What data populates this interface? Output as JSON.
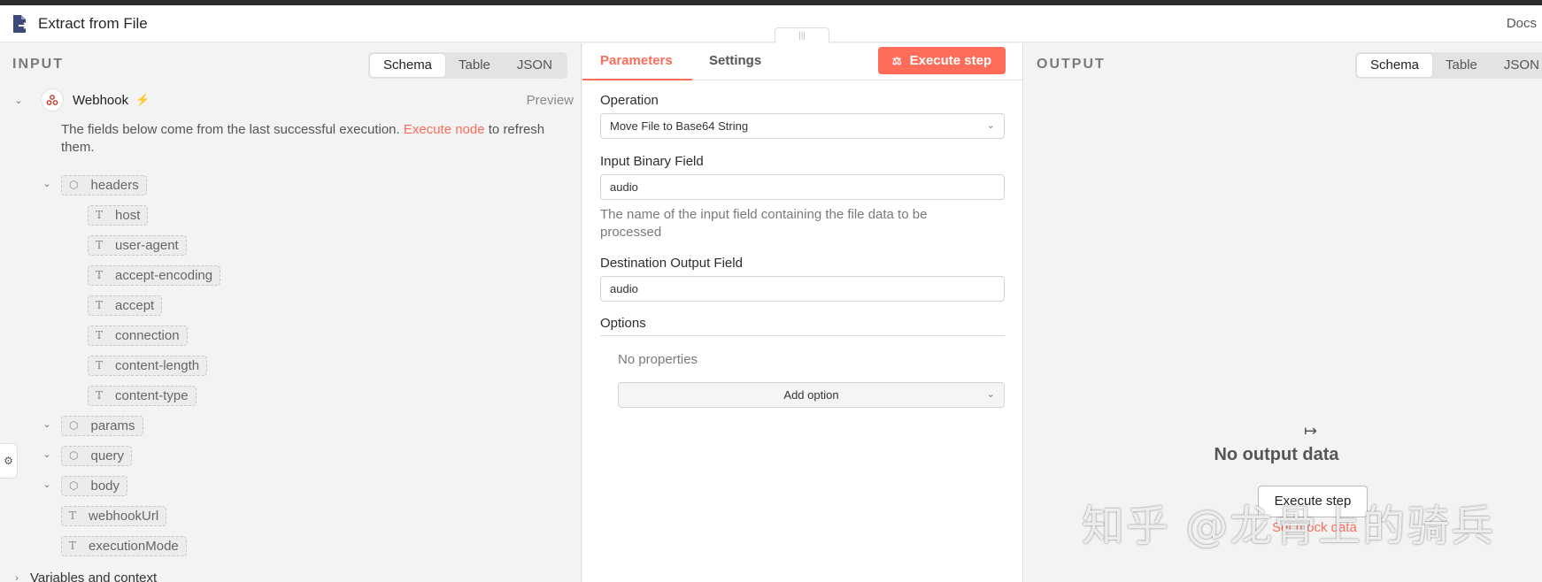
{
  "header": {
    "title": "Extract from File",
    "docs_label": "Docs"
  },
  "input_panel": {
    "label": "INPUT",
    "view_tabs": [
      "Schema",
      "Table",
      "JSON"
    ],
    "node": {
      "name": "Webhook",
      "preview_label": "Preview"
    },
    "info": {
      "text_before": "The fields below come from the last successful execution. ",
      "link": "Execute node",
      "text_after": " to refresh them."
    },
    "schema": {
      "headers": {
        "label": "headers",
        "fields": [
          "host",
          "user-agent",
          "accept-encoding",
          "accept",
          "connection",
          "content-length",
          "content-type"
        ]
      },
      "params": "params",
      "query": "query",
      "body": "body",
      "extra_fields": [
        "webhookUrl",
        "executionMode"
      ]
    },
    "variables_label": "Variables and context"
  },
  "parameters_panel": {
    "tabs": {
      "parameters": "Parameters",
      "settings": "Settings"
    },
    "execute_label": "Execute step",
    "operation": {
      "label": "Operation",
      "value": "Move File to Base64 String"
    },
    "input_binary": {
      "label": "Input Binary Field",
      "value": "audio",
      "hint": "The name of the input field containing the file data to be processed"
    },
    "destination": {
      "label": "Destination Output Field",
      "value": "audio"
    },
    "options": {
      "label": "Options",
      "empty": "No properties",
      "add_label": "Add option"
    }
  },
  "output_panel": {
    "label": "OUTPUT",
    "view_tabs": [
      "Schema",
      "Table",
      "JSON"
    ],
    "empty_title": "No output data",
    "empty_button": "Execute step",
    "empty_link": "Set mock data"
  },
  "watermark": "知乎 @龙骨上的骑兵",
  "colors": {
    "accent": "#ff6d5a"
  }
}
